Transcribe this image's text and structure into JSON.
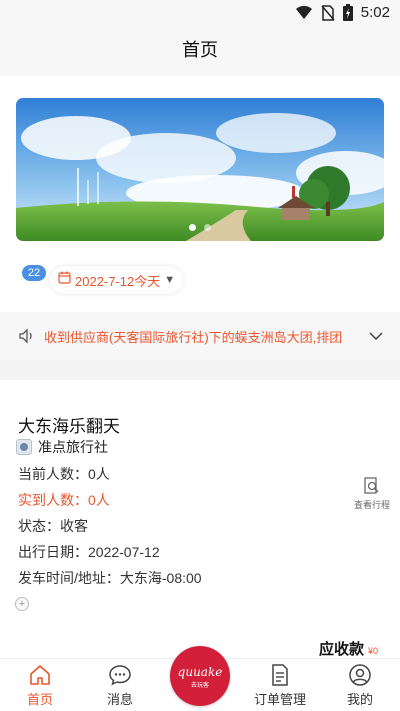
{
  "status_bar": {
    "time": "5:02"
  },
  "header": {
    "title": "首页"
  },
  "banner": {
    "slide_count": 2,
    "active_slide": 1
  },
  "date_filter": {
    "badge": "22",
    "label": "2022-7-12今天"
  },
  "notice": {
    "text": "收到供应商(天客国际旅行社)下的蜈支洲岛大团,排团"
  },
  "trip": {
    "title": "大东海乐翻天",
    "agency": "准点旅行社",
    "current_count": "当前人数：0人",
    "arrived_count": "实到人数：0人",
    "status": "状态：收客",
    "departure_date": "出行日期：2022-07-12",
    "pickup": "发车时间/地址：大东海-08:00",
    "view_itinerary": "查看行程"
  },
  "receivable": {
    "label": "应收款",
    "amount": "¥0"
  },
  "tabs": [
    {
      "label": "首页",
      "icon": "home-icon",
      "active": true
    },
    {
      "label": "消息",
      "icon": "message-icon",
      "active": false
    },
    {
      "label": "订单管理",
      "icon": "order-icon",
      "active": false
    },
    {
      "label": "我的",
      "icon": "profile-icon",
      "active": false
    }
  ],
  "center_button": {
    "brand": "quuake",
    "brand_sub": "去玩客"
  },
  "colors": {
    "accent": "#e8562e",
    "badge": "#4a90e2",
    "center": "#d3203a"
  }
}
